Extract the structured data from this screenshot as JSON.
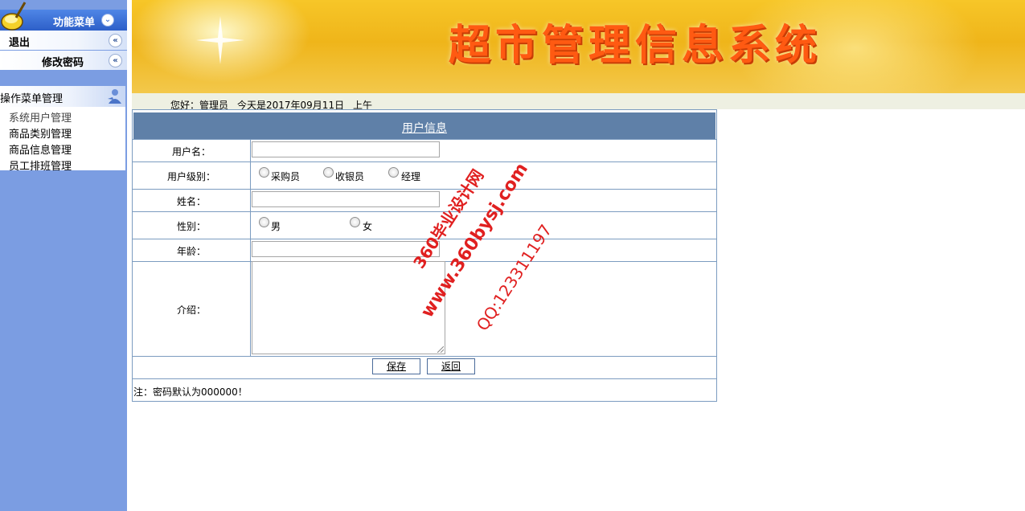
{
  "sidebar": {
    "menu_title": "功能菜单",
    "utility": [
      {
        "label": "退出"
      },
      {
        "label": "修改密码"
      }
    ],
    "panel_title": "操作菜单管理",
    "items": [
      {
        "label": "系统用户管理"
      },
      {
        "label": "商品类别管理"
      },
      {
        "label": "商品信息管理"
      },
      {
        "label": "员工排班管理"
      }
    ]
  },
  "header": {
    "system_title": "超市管理信息系统",
    "greeting": "您好：管理员",
    "date_text": "今天是2017年09月11日",
    "period": "上午"
  },
  "form": {
    "title": "用户信息",
    "username_label": "用户名：",
    "level_label": "用户级别：",
    "level_options": [
      "采购员",
      "收银员",
      "经理"
    ],
    "name_label": "姓名：",
    "gender_label": "性别：",
    "gender_options": [
      "男",
      "女"
    ],
    "age_label": "年龄：",
    "intro_label": "介绍：",
    "save_label": "保存",
    "back_label": "返回",
    "note": "注：密码默认为000000！",
    "values": {
      "username": "",
      "name": "",
      "age": "",
      "intro": ""
    }
  },
  "watermark": {
    "line1": "360毕业设计网",
    "line2": "www.360bysj.com",
    "line3": "QQ:123311197"
  },
  "colors": {
    "sidebar_bg": "#7b9de2",
    "form_header_bg": "#5f80a8",
    "title_orange": "#ff5a12",
    "watermark_red": "#e02020"
  }
}
